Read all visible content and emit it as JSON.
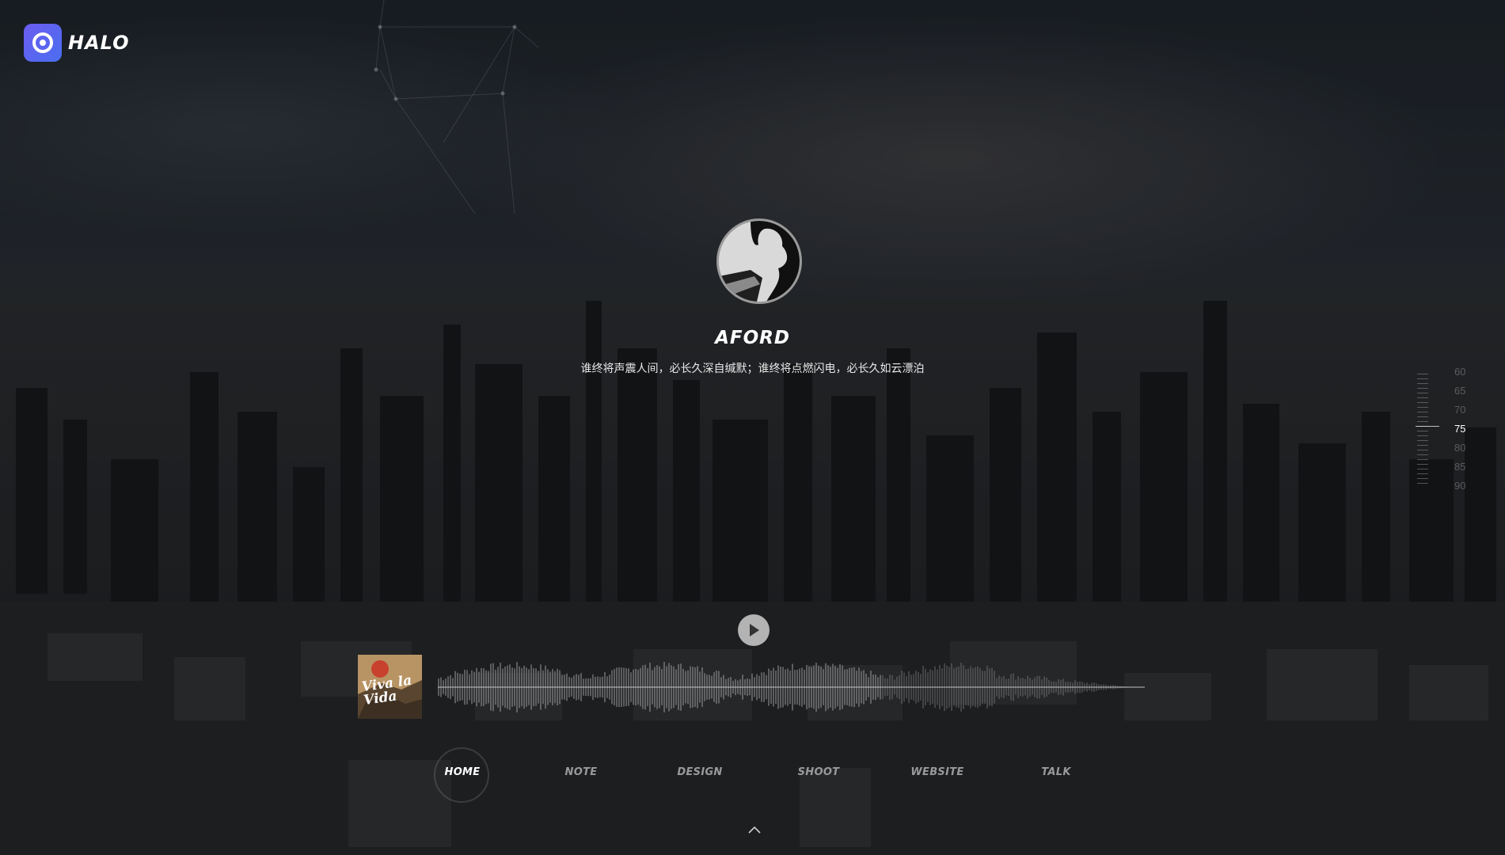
{
  "brand": {
    "logo_text": "HALO",
    "accent_color": "#5b63f0"
  },
  "profile": {
    "name": "AFORD",
    "motto": "谁终将声震人间，必长久深自缄默；谁终将点燃闪电，必长久如云漂泊"
  },
  "scale": {
    "labels": [
      "60",
      "65",
      "70",
      "75",
      "80",
      "85",
      "90"
    ],
    "active": "75"
  },
  "player": {
    "album_text": "Viva la Vida",
    "play_icon": "play-icon"
  },
  "nav": {
    "items": [
      {
        "label": "HOME",
        "active": true
      },
      {
        "label": "NOTE",
        "active": false
      },
      {
        "label": "DESIGN",
        "active": false
      },
      {
        "label": "SHOOT",
        "active": false
      },
      {
        "label": "WEBSITE",
        "active": false
      },
      {
        "label": "TALK",
        "active": false
      }
    ],
    "up_icon": "chevron-up-icon"
  }
}
